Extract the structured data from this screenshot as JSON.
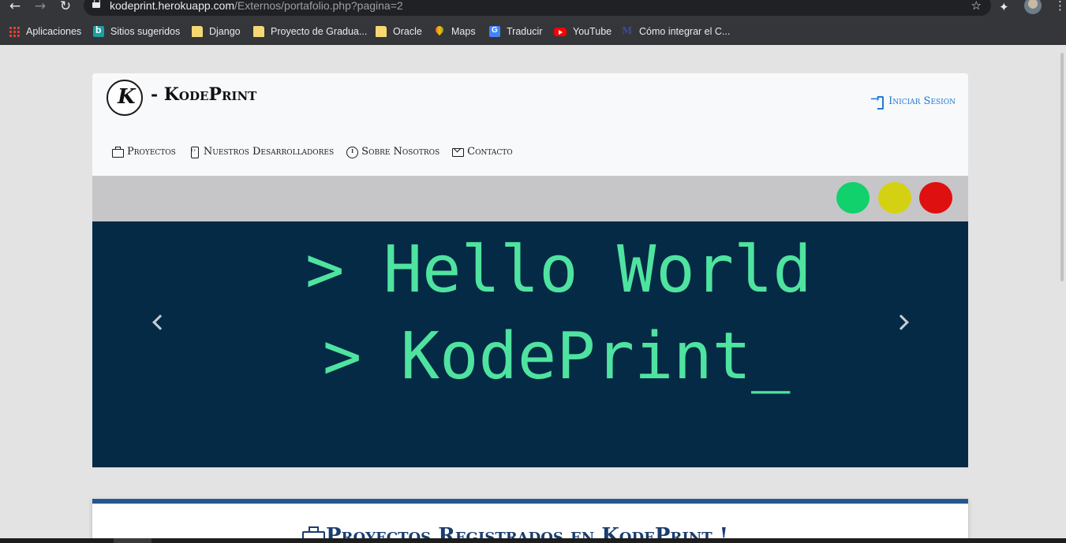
{
  "browser": {
    "url_host": "kodeprint.herokuapp.com",
    "url_path": "/Externos/portafolio.php?pagina=2",
    "bookmarks": [
      {
        "label": "Aplicaciones",
        "icon": "apps-grid-icon"
      },
      {
        "label": "Sitios sugeridos",
        "icon": "bing-icon"
      },
      {
        "label": "Django",
        "icon": "folder-icon"
      },
      {
        "label": "Proyecto de Gradua...",
        "icon": "folder-icon"
      },
      {
        "label": "Oracle",
        "icon": "folder-icon"
      },
      {
        "label": "Maps",
        "icon": "maps-icon"
      },
      {
        "label": "Traducir",
        "icon": "translate-icon"
      },
      {
        "label": "YouTube",
        "icon": "youtube-icon"
      },
      {
        "label": "Cómo integrar el C...",
        "icon": "m-site-icon"
      }
    ]
  },
  "header": {
    "brand": "- KodePrint",
    "login_label": "Iniciar Sesion",
    "menu": [
      {
        "label": "Proyectos",
        "icon": "briefcase-icon"
      },
      {
        "label": "Nuestros Desarrolladores",
        "icon": "phone-code-icon"
      },
      {
        "label": "Sobre Nosotros",
        "icon": "info-icon"
      },
      {
        "label": "Contacto",
        "icon": "mail-icon"
      }
    ]
  },
  "hero": {
    "line1": "> Hello World",
    "line2": "> KodePrint_",
    "dots": [
      "#10d16b",
      "#d4d113",
      "#df1010"
    ],
    "background": "#052a45",
    "text_color": "#4fe3a0"
  },
  "section": {
    "title": "Proyectos Registrados en KodePrint !",
    "accent": "#23578f"
  }
}
